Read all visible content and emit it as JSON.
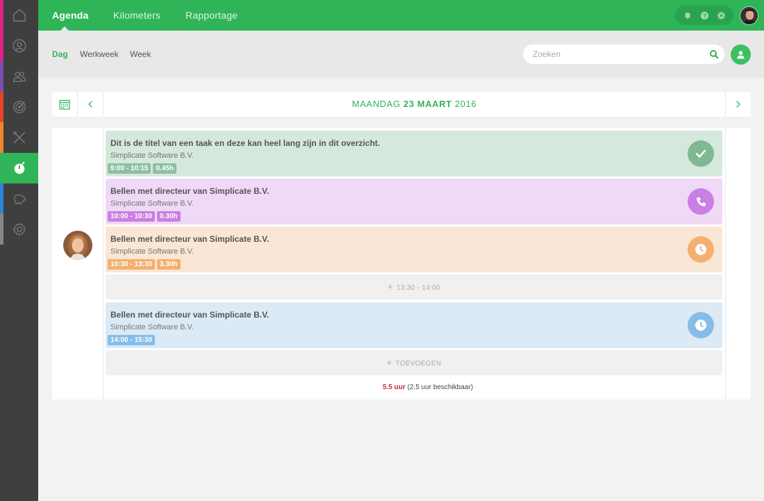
{
  "sidebar": {
    "items": [
      {
        "name": "home",
        "stripe": "#e0218a"
      },
      {
        "name": "contacts",
        "stripe": "#e0218a"
      },
      {
        "name": "relations",
        "stripe": "#7b4db1"
      },
      {
        "name": "goals",
        "stripe": "#e8422f"
      },
      {
        "name": "tools",
        "stripe": "#f0862a"
      },
      {
        "name": "timer",
        "stripe": "#2fb457",
        "active": true
      },
      {
        "name": "finance",
        "stripe": "#2c87d7"
      },
      {
        "name": "settings",
        "stripe": "#888888"
      }
    ]
  },
  "topbar": {
    "tabs": [
      "Agenda",
      "Kilometers",
      "Rapportage"
    ],
    "active_tab": "Agenda"
  },
  "subbar": {
    "views": [
      "Dag",
      "Werkweek",
      "Week"
    ],
    "active_view": "Dag",
    "search_placeholder": "Zoeken"
  },
  "datebar": {
    "day": "MAANDAG",
    "date": "23 MAART",
    "year": "2016"
  },
  "agenda": {
    "tasks": [
      {
        "title": "Dit is de titel van een taak en deze kan heel lang zijn in dit overzicht.",
        "company": "Simplicate Software B.V.",
        "time": "9:00 - 10:15",
        "duration": "0.45h",
        "bg": "#d5e8dc",
        "badge": "#8fbf9f",
        "status_bg": "#7fb893",
        "status": "check"
      },
      {
        "title": "Bellen met directeur van Simplicate B.V.",
        "company": "Simplicate Software B.V.",
        "time": "10:00 - 10:30",
        "duration": "0.30h",
        "bg": "#efd9f6",
        "badge": "#c97fe4",
        "status_bg": "#c97fe4",
        "status": "phone"
      },
      {
        "title": "Bellen met directeur van Simplicate B.V.",
        "company": "Simplicate Software B.V.",
        "time": "10:30 - 13:30",
        "duration": "3.30h",
        "bg": "#fae6d4",
        "badge": "#f2b071",
        "status_bg": "#f2b071",
        "status": "clock"
      },
      {
        "title": "Bellen met directeur van Simplicate B.V.",
        "company": "Simplicate Software B.V.",
        "time": "14:00 - 15:30",
        "duration": "",
        "bg": "#dceaf6",
        "badge": "#85bde8",
        "status_bg": "#85bde8",
        "status": "clock"
      }
    ],
    "free_slot": "13:30 - 14:00",
    "add_label": "TOEVOEGEN",
    "total_hours": "5.5 uur",
    "total_available": "(2,5 uur beschikbaar)"
  }
}
